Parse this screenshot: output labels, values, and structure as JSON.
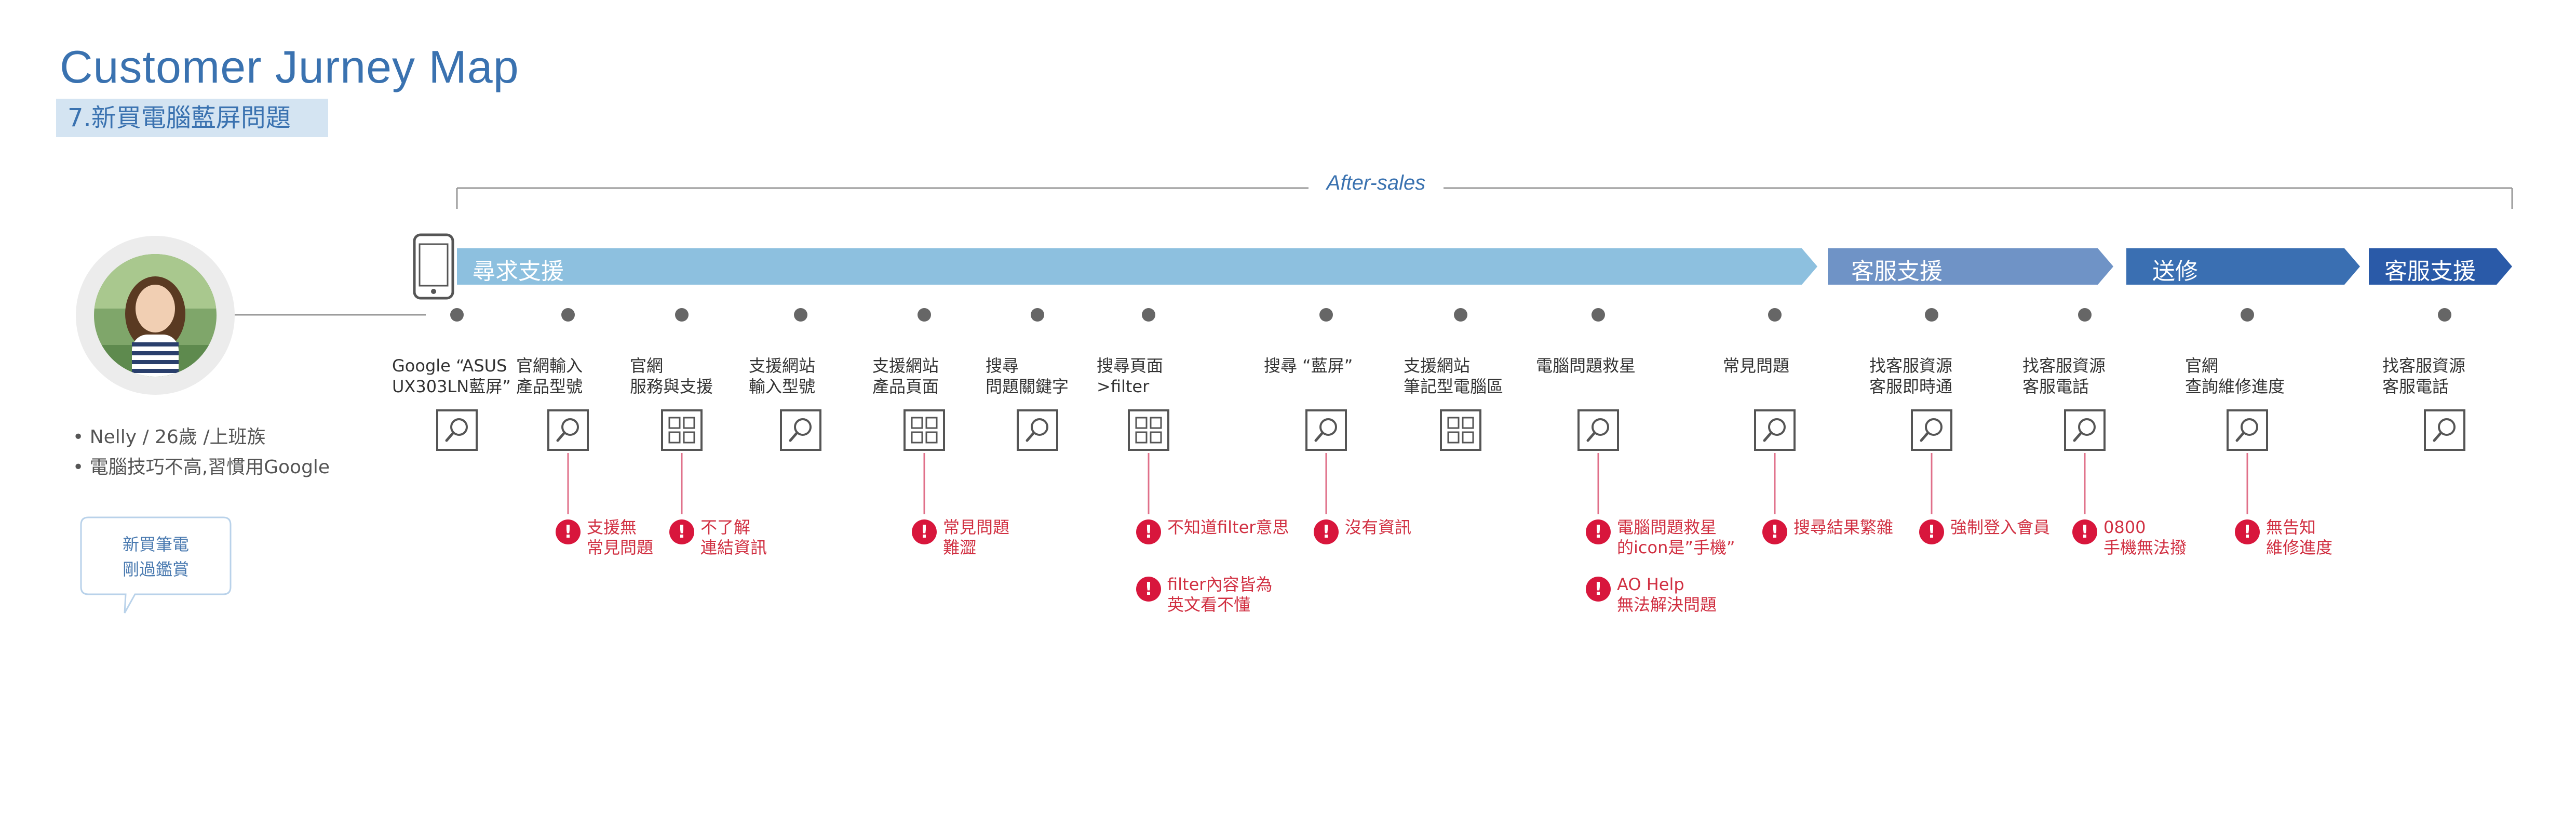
{
  "header": {
    "title": "Customer Jurney Map",
    "subtitle": "7.新買電腦藍屏問題"
  },
  "phase_label": "After-sales",
  "persona": {
    "bullets": [
      "Nelly / 26歲 /上班族",
      "電腦技巧不高,習慣用Google"
    ],
    "bubble": "新買筆電\n剛過鑑賞"
  },
  "stages": [
    {
      "label": "尋求支援",
      "color": "#8dc0df"
    },
    {
      "label": "客服支援",
      "color": "#6f93c6"
    },
    {
      "label": "送修",
      "color": "#3a6fb2"
    },
    {
      "label": "客服支援",
      "color": "#2a5aa8"
    }
  ],
  "steps": [
    {
      "label": "Google “ASUS\nUX303LN藍屏”",
      "icon": "search-icon"
    },
    {
      "label": "官網輸入\n產品型號",
      "icon": "search-icon"
    },
    {
      "label": "官網\n服務與支援",
      "icon": "grid-icon"
    },
    {
      "label": "支援網站\n輸入型號",
      "icon": "search-icon"
    },
    {
      "label": "支援網站\n產品頁面",
      "icon": "grid-icon"
    },
    {
      "label": "搜尋\n問題關鍵字",
      "icon": "search-icon"
    },
    {
      "label": "搜尋頁面\n>filter",
      "icon": "grid-icon"
    },
    {
      "label": "搜尋 “藍屏”",
      "icon": "search-icon"
    },
    {
      "label": "支援網站\n筆記型電腦區",
      "icon": "grid-icon"
    },
    {
      "label": "電腦問題救星",
      "icon": "search-icon"
    },
    {
      "label": "常見問題",
      "icon": "search-icon"
    },
    {
      "label": "找客服資源\n客服即時通",
      "icon": "search-icon"
    },
    {
      "label": "找客服資源\n客服電話",
      "icon": "search-icon"
    },
    {
      "label": "官網\n查詢維修進度",
      "icon": "search-icon"
    },
    {
      "label": "找客服資源\n客服電話",
      "icon": "search-icon"
    }
  ],
  "pain_points": [
    {
      "step": 1,
      "text": "支援無\n常見問題"
    },
    {
      "step": 2,
      "text": "不了解\n連結資訊"
    },
    {
      "step": 4,
      "text": "常見問題\n難澀"
    },
    {
      "step": 6,
      "text": "不知道filter意思"
    },
    {
      "step": 6,
      "text": "filter內容皆為\n英文看不懂"
    },
    {
      "step": 7,
      "text": "沒有資訊"
    },
    {
      "step": 9,
      "text": "電腦問題救星\n的icon是”手機”"
    },
    {
      "step": 9,
      "text": "AO Help\n無法解決問題"
    },
    {
      "step": 10,
      "text": "搜尋結果繁雜"
    },
    {
      "step": 11,
      "text": "強制登入會員"
    },
    {
      "step": 12,
      "text": "0800\n手機無法撥"
    },
    {
      "step": 13,
      "text": "無告知\n維修進度"
    }
  ]
}
